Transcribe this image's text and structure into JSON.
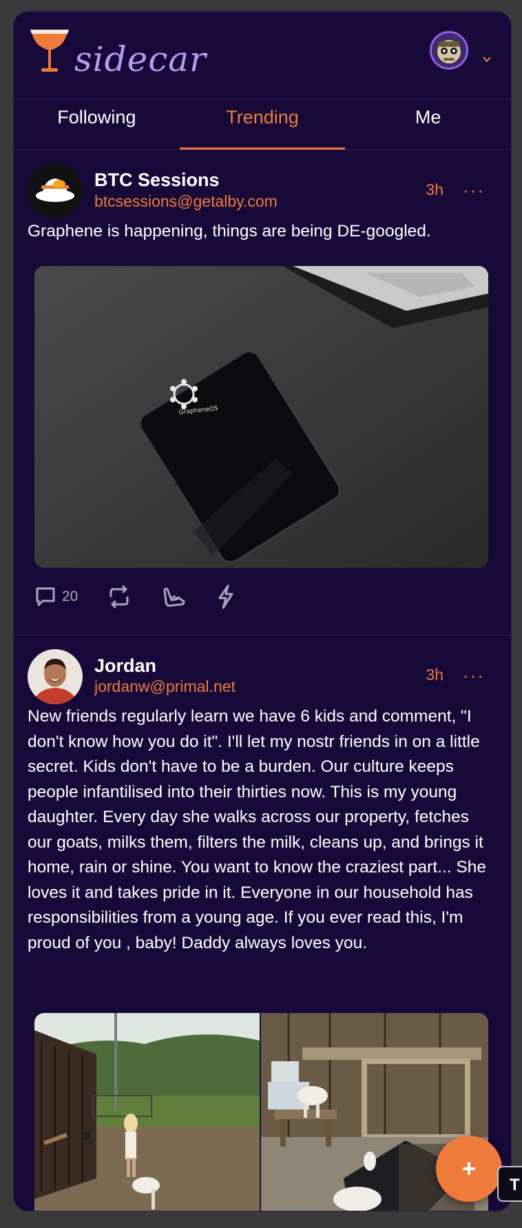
{
  "app": {
    "logo_text": "sidecar"
  },
  "tabs": [
    {
      "label": "Following"
    },
    {
      "label": "Trending"
    },
    {
      "label": "Me"
    }
  ],
  "posts": [
    {
      "name": "BTC Sessions",
      "handle": "btcsessions@getalby.com",
      "time": "3h",
      "more": "···",
      "content": "Graphene is happening, things are being DE-googled.",
      "image_caption": "GrapheneOS",
      "reply_count": "20"
    },
    {
      "name": "Jordan",
      "handle": "jordanw@primal.net",
      "time": "3h",
      "more": "···",
      "content": "New friends regularly learn we have 6 kids and comment, \"I don't know how you do it\".  I'll let my nostr friends in on a little secret. Kids don't have to be a burden. Our culture keeps people infantilised into their thirties now. This is my young daughter. Every day she walks across our property, fetches our goats, milks them, filters the milk, cleans up, and brings it home, rain or shine. You want to know the craziest part... She loves it and takes pride in it. Everyone in our household has responsibilities from a young age. If you ever read this, I'm proud of you , baby! Daddy always loves you."
    }
  ],
  "fab": {
    "label": "+"
  },
  "side_button": {
    "label": "T"
  },
  "colors": {
    "background": "#170a38",
    "accent": "#ee7b3a",
    "logo": "#b69cf0",
    "text": "#ffffff"
  }
}
